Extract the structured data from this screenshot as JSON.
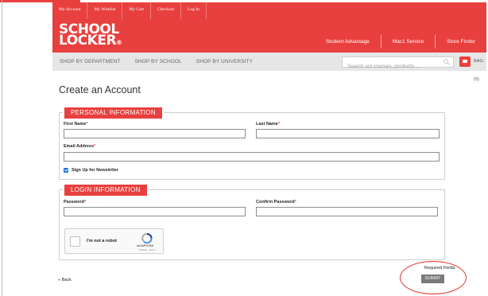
{
  "top_links": [
    "My Account",
    "My Wishlist",
    "My Cart",
    "Checkout",
    "Log In"
  ],
  "logo": {
    "line1": "SCHOOL",
    "line2": "LOCKER",
    "mark": "®"
  },
  "service_links": [
    "Student Advantage",
    "Mac1 Service",
    "Store Finder"
  ],
  "nav": {
    "items": [
      "SHOP BY DEPARTMENT",
      "SHOP BY SCHOOL",
      "SHOP BY UNIVERSITY"
    ],
    "search_placeholder": "Search uni courses, products ...",
    "bag_label": "BAG: (0)"
  },
  "page_title": "Create an Account",
  "personal": {
    "legend": "PERSONAL INFORMATION",
    "first_name": "First Name",
    "last_name": "Last Name",
    "email": "Email Address",
    "newsletter": "Sign Up for Newsletter",
    "newsletter_checked": true
  },
  "login": {
    "legend": "LOGIN INFORMATION",
    "password": "Password",
    "confirm_password": "Confirm Password"
  },
  "required_marker": "*",
  "captcha": {
    "label": "I'm not a robot",
    "brand": "reCAPTCHA",
    "terms": "Privacy - Terms"
  },
  "footer": {
    "back": "« Back",
    "required": "Required Fields",
    "submit": "SUBMIT"
  },
  "colors": {
    "brand_red": "#e8403e",
    "nav_bg": "#e6e6e6",
    "submit_bg": "#7a7a7a"
  }
}
